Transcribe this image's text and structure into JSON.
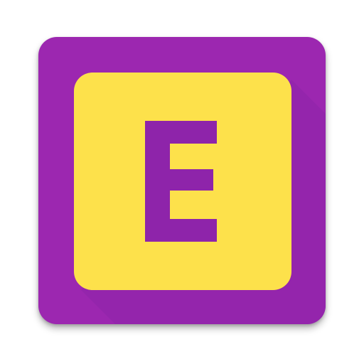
{
  "icon": {
    "name": "app-icon",
    "letter": "E",
    "colors": {
      "background": "#9c27b0",
      "background_shadow": "#8e24aa",
      "tile": "#fde14b",
      "letter": "#8e24aa"
    }
  }
}
